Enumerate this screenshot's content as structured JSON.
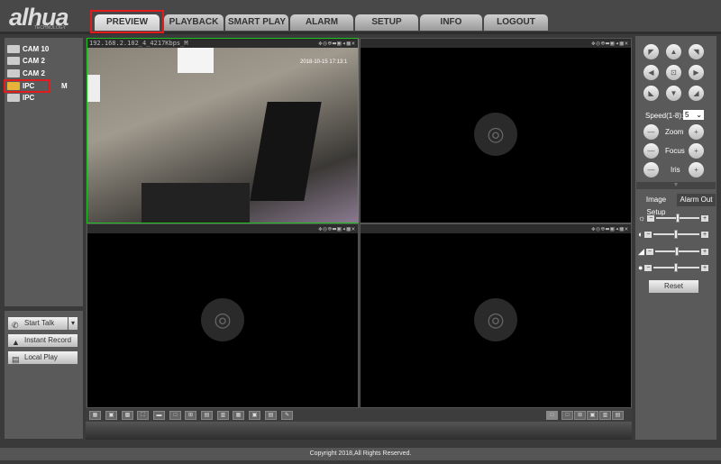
{
  "brand": {
    "logo": "alhua",
    "sub": "TECHNOLOGY"
  },
  "tabs": [
    {
      "label": "PREVIEW",
      "active": true
    },
    {
      "label": "PLAYBACK"
    },
    {
      "label": "SMART PLAY"
    },
    {
      "label": "ALARM"
    },
    {
      "label": "SETUP"
    },
    {
      "label": "INFO"
    },
    {
      "label": "LOGOUT"
    }
  ],
  "devices": [
    {
      "label": "CAM 10"
    },
    {
      "label": "CAM 2"
    },
    {
      "label": "CAM 2"
    },
    {
      "label": "IPC",
      "badge": "M",
      "selected": true
    },
    {
      "label": "IPC"
    }
  ],
  "actions": {
    "start_talk": "Start Talk",
    "instant_record": "Instant Record",
    "local_play": "Local Play"
  },
  "panes": [
    {
      "title": "192.168.2.102_4_4217Kbps_M",
      "timestamp": "2018-10-15 17:13:1",
      "active": true
    },
    {
      "title": ""
    },
    {
      "title": ""
    },
    {
      "title": ""
    }
  ],
  "pane_icons": "✥◎⊕▬▣◂▦✕",
  "ptz": {
    "speed_label": "Speed(1-8):",
    "speed_value": "5",
    "zoom": "Zoom",
    "focus": "Focus",
    "iris": "Iris"
  },
  "image_tabs": {
    "image_setup": "Image Setup",
    "alarm_out": "Alarm Out"
  },
  "image_sliders": [
    {
      "name": "brightness",
      "level": 0.5
    },
    {
      "name": "contrast",
      "level": 0.5
    },
    {
      "name": "saturation",
      "level": 0.5
    },
    {
      "name": "hue",
      "level": 0.5
    }
  ],
  "reset": "Reset",
  "footer": "Copyright 2018,All Rights Reserved.",
  "colors": {
    "highlight": "#e21c1c",
    "active_pane": "#1fbf1f"
  }
}
